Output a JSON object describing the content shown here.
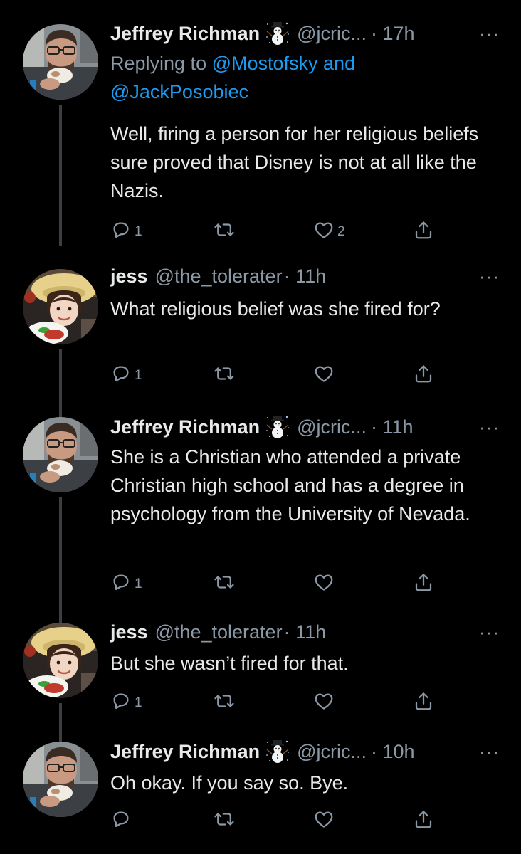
{
  "theme": {
    "background": "#000000",
    "text": "#e7e9ea",
    "muted": "#8b98a5",
    "link": "#1d9bf0",
    "thread_line": "#3b3f43"
  },
  "tweets": [
    {
      "name": "Jeffrey Richman",
      "badge": "snowman-emoji",
      "handle": "@jcric...",
      "time": "· 17h",
      "reply_prefix": "Replying to ",
      "reply_mentions": "@Mostofsky and @JackPosobiec",
      "text": "Well, firing a person for her religious beliefs sure proved that Disney is not at all like the Nazis.",
      "replies": "1",
      "retweets": "",
      "likes": "2"
    },
    {
      "name": "jess",
      "handle": "@the_tolerater",
      "time": "· 11h",
      "text": "What religious belief was she fired for?",
      "replies": "1",
      "retweets": "",
      "likes": ""
    },
    {
      "name": "Jeffrey Richman",
      "badge": "snowman-emoji",
      "handle": "@jcric...",
      "time": "· 11h",
      "text": "She is a Christian who attended a private Christian high school and has a degree in psychology from the University of Nevada.",
      "replies": "1",
      "retweets": "",
      "likes": ""
    },
    {
      "name": "jess",
      "handle": "@the_tolerater",
      "time": "· 11h",
      "text": "But she wasn’t fired for that.",
      "replies": "1",
      "retweets": "",
      "likes": ""
    },
    {
      "name": "Jeffrey Richman",
      "badge": "snowman-emoji",
      "handle": "@jcric...",
      "time": "· 10h",
      "text": "Oh okay.  If you say so.  Bye.",
      "replies": "",
      "retweets": "",
      "likes": ""
    }
  ],
  "more_glyph": "···"
}
